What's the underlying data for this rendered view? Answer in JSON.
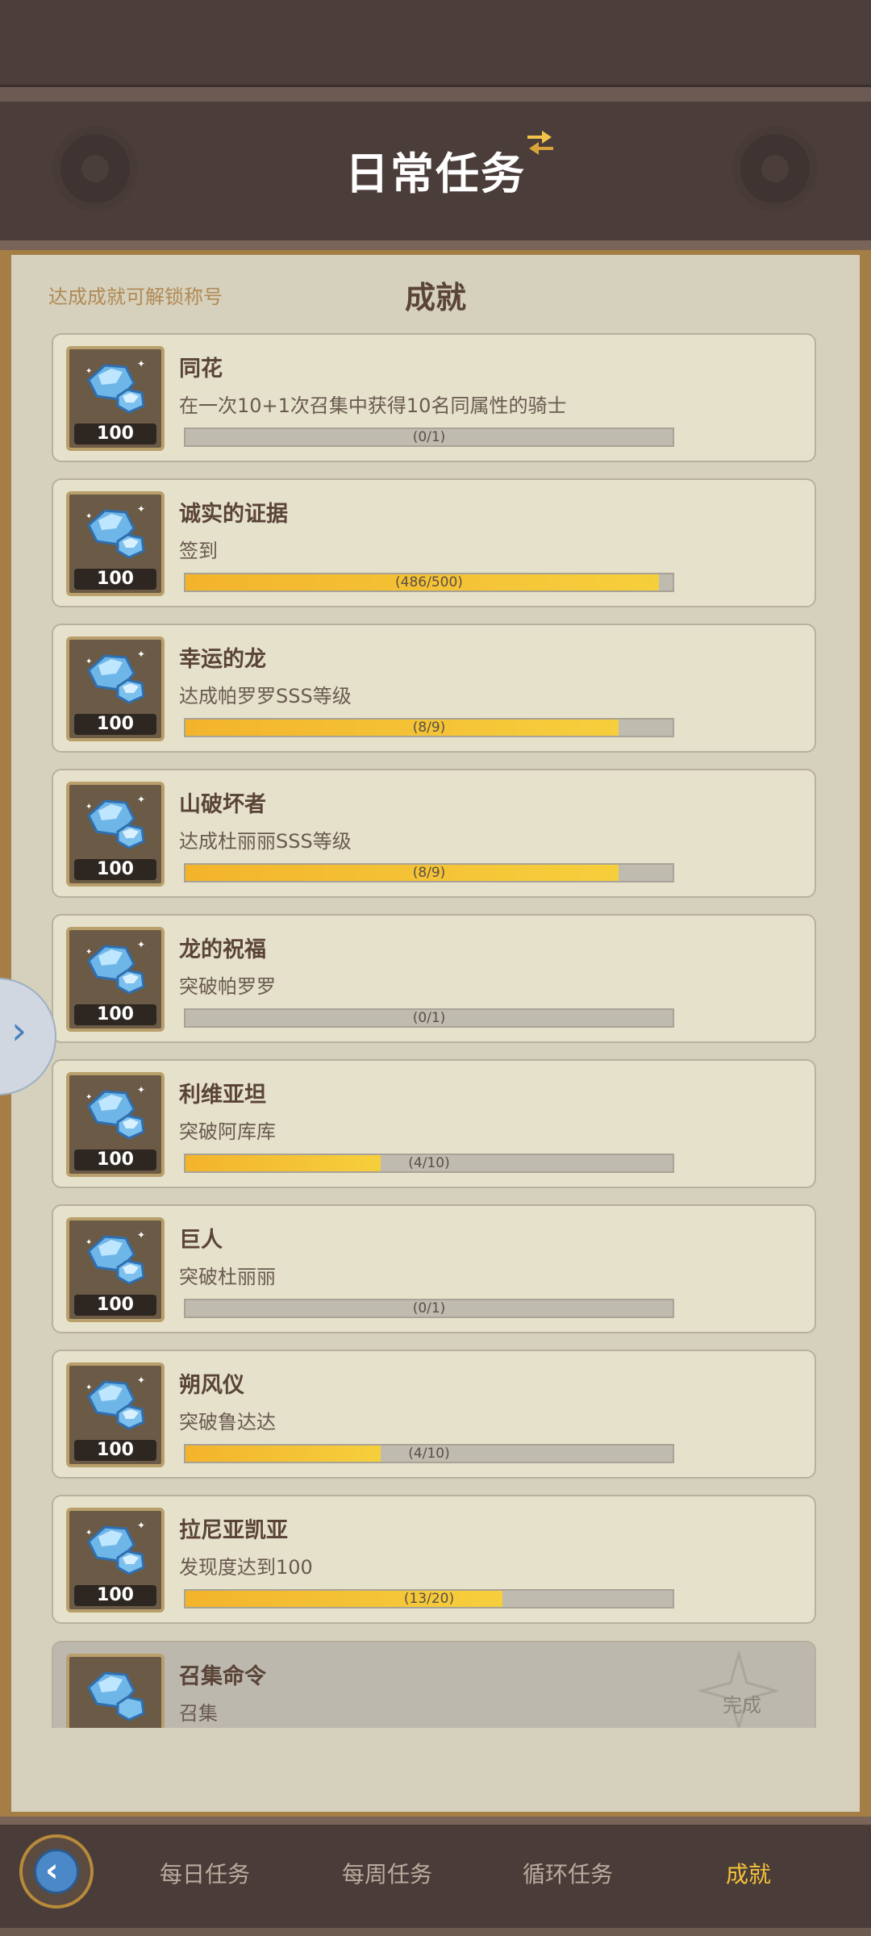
{
  "header": {
    "title": "日常任务"
  },
  "panel": {
    "hint": "达成成就可解锁称号",
    "section_title": "成就"
  },
  "tasks": [
    {
      "title": "同花",
      "desc": "在一次10+1次召集中获得10名同属性的骑士",
      "reward": "100",
      "progress_text": "(0/1)",
      "progress": 0.0
    },
    {
      "title": "诚实的证据",
      "desc": "签到",
      "reward": "100",
      "progress_text": "(486/500)",
      "progress": 0.972
    },
    {
      "title": "幸运的龙",
      "desc": "达成帕罗罗SSS等级",
      "reward": "100",
      "progress_text": "(8/9)",
      "progress": 0.889
    },
    {
      "title": "山破坏者",
      "desc": "达成杜丽丽SSS等级",
      "reward": "100",
      "progress_text": "(8/9)",
      "progress": 0.889
    },
    {
      "title": "龙的祝福",
      "desc": "突破帕罗罗",
      "reward": "100",
      "progress_text": "(0/1)",
      "progress": 0.0
    },
    {
      "title": "利维亚坦",
      "desc": "突破阿库库",
      "reward": "100",
      "progress_text": "(4/10)",
      "progress": 0.4
    },
    {
      "title": "巨人",
      "desc": "突破杜丽丽",
      "reward": "100",
      "progress_text": "(0/1)",
      "progress": 0.0
    },
    {
      "title": "朔风仪",
      "desc": "突破鲁达达",
      "reward": "100",
      "progress_text": "(4/10)",
      "progress": 0.4
    },
    {
      "title": "拉尼亚凯亚",
      "desc": "发现度达到100",
      "reward": "100",
      "progress_text": "(13/20)",
      "progress": 0.65
    }
  ],
  "completed_task": {
    "title": "召集命令",
    "desc": "召集",
    "status": "完成"
  },
  "nav": {
    "items": [
      "每日任务",
      "每周任务",
      "循环任务",
      "成就"
    ],
    "active": "成就"
  },
  "colors": {
    "accent": "#f4c23a",
    "bar_fill": "#f5c033"
  }
}
